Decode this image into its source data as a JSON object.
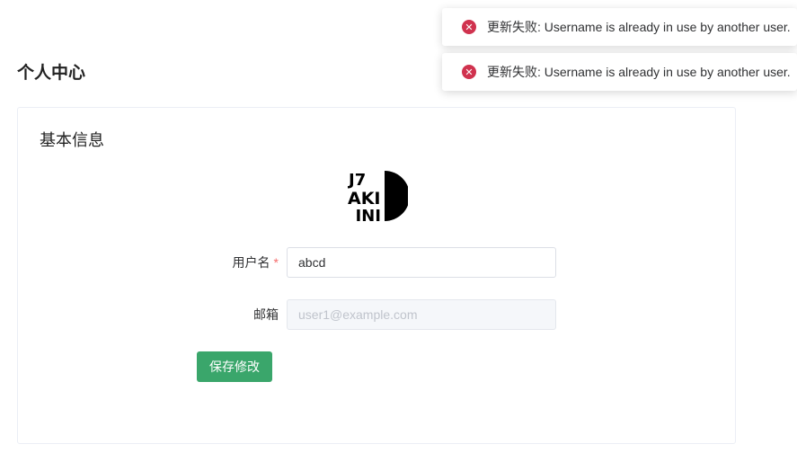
{
  "page": {
    "title": "个人中心"
  },
  "card": {
    "title": "基本信息",
    "avatar_icon": "akiani-logo-icon"
  },
  "form": {
    "username": {
      "label": "用户名",
      "required_mark": "*",
      "value": "abcd"
    },
    "email": {
      "label": "邮箱",
      "placeholder": "user1@example.com",
      "disabled": true
    },
    "save_label": "保存修改"
  },
  "toasts": [
    {
      "icon": "error-x-icon",
      "message": "更新失败: Username is already in use by another user."
    },
    {
      "icon": "error-x-icon",
      "message": "更新失败: Username is already in use by another user."
    }
  ],
  "colors": {
    "primary_button": "#3aa66b",
    "error_icon": "#d0324e",
    "required_star": "#f56c6c"
  }
}
